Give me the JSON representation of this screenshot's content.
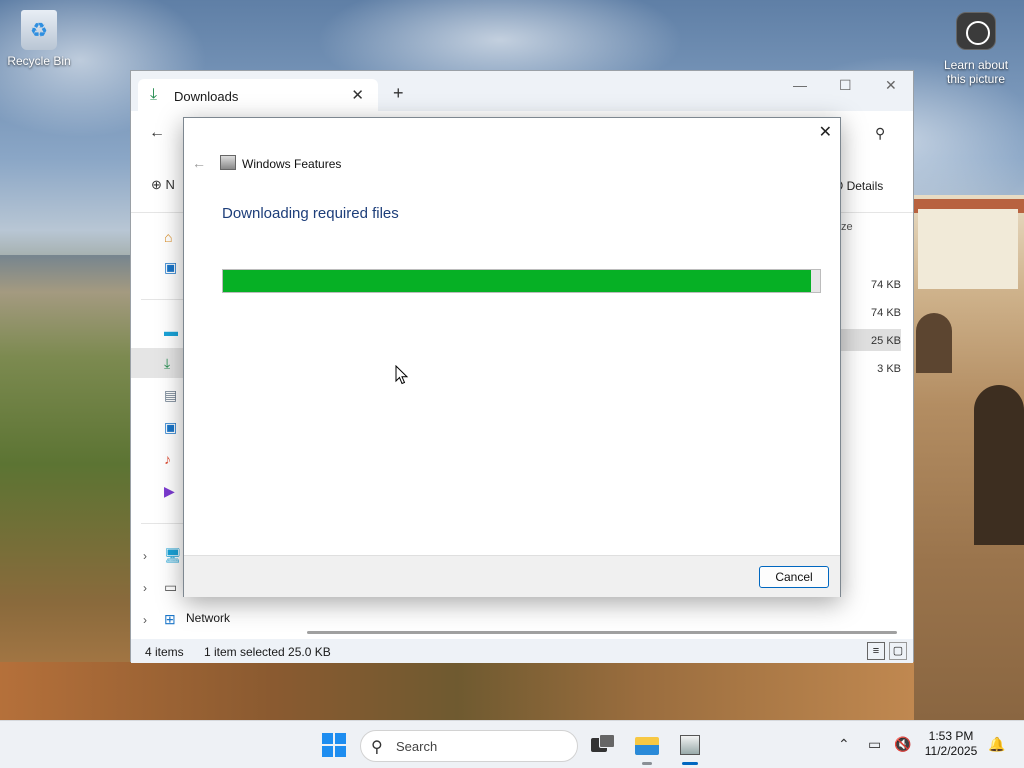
{
  "desktop": {
    "icons": [
      {
        "label": "Recycle Bin"
      },
      {
        "label": "Learn about this picture"
      }
    ]
  },
  "explorer": {
    "tab_title": "Downloads",
    "toolbar": {
      "new_label": "N",
      "details_label": "Details"
    },
    "nav": {
      "network_label": "Network"
    },
    "list": {
      "size_header": "ze",
      "sizes": [
        "74 KB",
        "74 KB",
        "25 KB",
        "3 KB"
      ]
    },
    "status": {
      "items": "4 items",
      "selected": "1 item selected  25.0 KB"
    }
  },
  "dialog": {
    "title": "Windows Features",
    "heading": "Downloading required files",
    "progress": 0.985,
    "cancel_label": "Cancel"
  },
  "taskbar": {
    "search_placeholder": "Search",
    "time": "1:53 PM",
    "date": "11/2/2025"
  },
  "colors": {
    "progress_fill": "#06b025",
    "heading": "#1d3e7a",
    "accent": "#0067c0"
  }
}
